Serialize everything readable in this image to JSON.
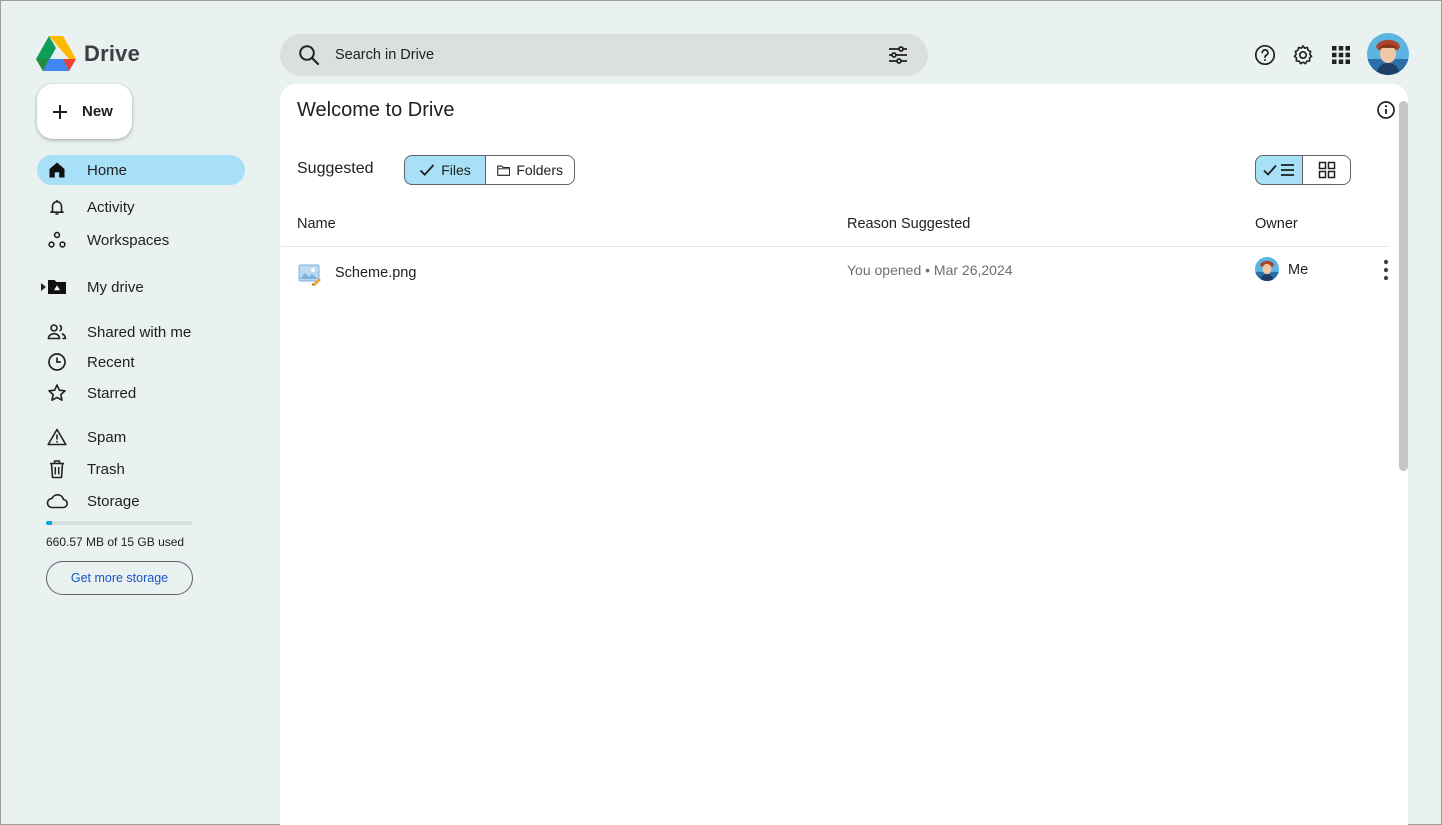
{
  "app": {
    "title": "Drive"
  },
  "new_button": {
    "label": "New"
  },
  "sidebar": {
    "items": [
      {
        "label": "Home",
        "icon": "home-icon"
      },
      {
        "label": "Activity",
        "icon": "bell-icon"
      },
      {
        "label": "Workspaces",
        "icon": "workspaces-icon"
      },
      {
        "label": "My drive",
        "icon": "my-drive-icon"
      },
      {
        "label": "Shared with me",
        "icon": "people-icon"
      },
      {
        "label": "Recent",
        "icon": "clock-icon"
      },
      {
        "label": "Starred",
        "icon": "star-icon"
      },
      {
        "label": "Spam",
        "icon": "warning-icon"
      },
      {
        "label": "Trash",
        "icon": "trash-icon"
      },
      {
        "label": "Storage",
        "icon": "cloud-icon"
      }
    ],
    "active": "Home",
    "storage": {
      "used_fraction": 0.043,
      "text": "660.57 MB  of 15 GB used",
      "button_label": "Get more storage"
    }
  },
  "search": {
    "placeholder": "Search in Drive",
    "value": ""
  },
  "main": {
    "heading": "Welcome to Drive",
    "suggested_label": "Suggested",
    "filter_chips": [
      {
        "label": "Files",
        "selected": true
      },
      {
        "label": "Folders",
        "selected": false
      }
    ],
    "view_mode": "list",
    "columns": {
      "name": "Name",
      "reason": "Reason Suggested",
      "owner": "Owner"
    },
    "files": [
      {
        "name": "Scheme.png",
        "reason": "You opened • Mar 26,2024",
        "owner": "Me",
        "icon": "image-file-icon"
      }
    ]
  },
  "colors": {
    "background": "#e9f1f1",
    "active_nav": "#a8e0f7",
    "storage_fill": "#0ba5e9",
    "link": "#1a56c6"
  }
}
